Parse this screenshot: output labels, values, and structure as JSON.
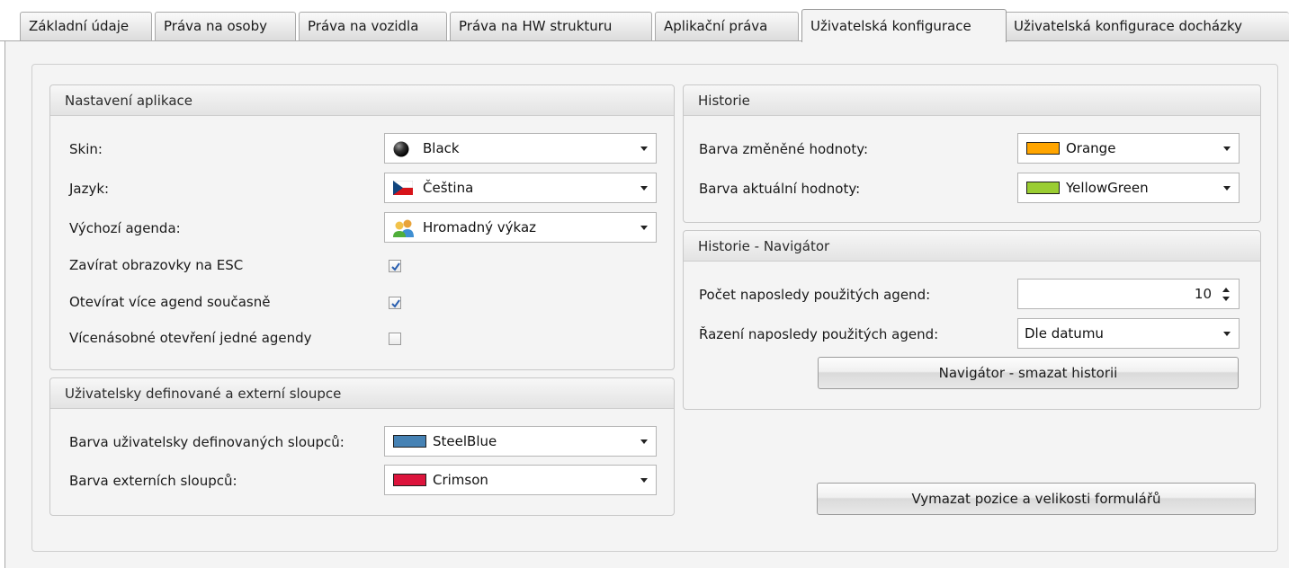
{
  "tabs": [
    {
      "label": "Základní údaje"
    },
    {
      "label": "Práva na osoby"
    },
    {
      "label": "Práva na vozidla"
    },
    {
      "label": "Práva na HW strukturu"
    },
    {
      "label": "Aplikační práva"
    },
    {
      "label": "Uživatelská konfigurace"
    },
    {
      "label": "Uživatelská konfigurace docházky"
    }
  ],
  "app_settings": {
    "title": "Nastavení aplikace",
    "skin_label": "Skin:",
    "skin_value": "Black",
    "language_label": "Jazyk:",
    "language_value": "Čeština",
    "default_agenda_label": "Výchozí agenda:",
    "default_agenda_value": "Hromadný výkaz",
    "close_on_esc_label": "Zavírat obrazovky na ESC",
    "close_on_esc_checked": true,
    "multi_open_label": "Otevírat více agend současně",
    "multi_open_checked": true,
    "repeat_open_label": "Vícenásobné otevření jedné agendy",
    "repeat_open_checked": false
  },
  "columns": {
    "title": "Uživatelsky definované a externí sloupce",
    "user_color_label": "Barva uživatelsky definovaných sloupců:",
    "user_color_value": "SteelBlue",
    "user_color_hex": "#4682b4",
    "external_color_label": "Barva externích sloupců:",
    "external_color_value": "Crimson",
    "external_color_hex": "#dc143c"
  },
  "history": {
    "title": "Historie",
    "changed_label": "Barva změněné hodnoty:",
    "changed_value": "Orange",
    "changed_hex": "#ffa500",
    "current_label": "Barva aktuální hodnoty:",
    "current_value": "YellowGreen",
    "current_hex": "#9acd32"
  },
  "navigator": {
    "title": "Historie - Navigátor",
    "count_label": "Počet naposledy použitých agend:",
    "count_value": "10",
    "sort_label": "Řazení naposledy použitých agend:",
    "sort_value": "Dle datumu",
    "clear_button": "Navigátor - smazat historii"
  },
  "reset_button": "Vymazat pozice a velikosti formulářů"
}
